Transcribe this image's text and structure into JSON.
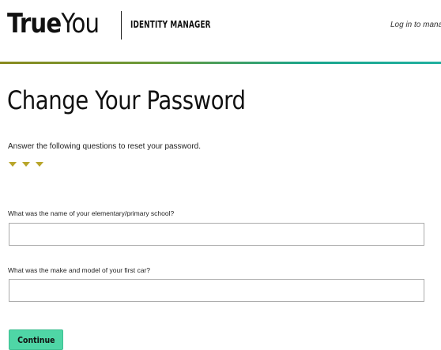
{
  "header": {
    "logo_bold": "True",
    "logo_light": "You",
    "product_name": "IDENTITY MANAGER",
    "login_link": "Log in to mana"
  },
  "main": {
    "title": "Change Your Password",
    "instructions": "Answer the following questions to reset your password.",
    "arrow_icon_count": 3,
    "questions": [
      {
        "label": "What was the name of your elementary/primary school?",
        "value": "",
        "placeholder": ""
      },
      {
        "label": "What was the make and model of your first car?",
        "value": "",
        "placeholder": ""
      }
    ],
    "continue_label": "Continue"
  },
  "colors": {
    "accent_button": "#4fd6a6",
    "arrow": "#b8a52a",
    "header_rule_start": "#8a8a1e",
    "header_rule_end": "#21b0a0"
  }
}
